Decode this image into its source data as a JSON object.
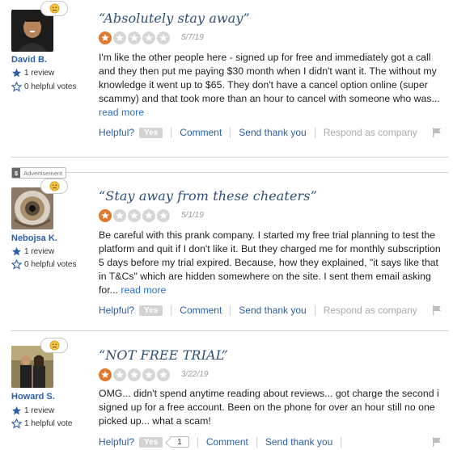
{
  "reviews": [
    {
      "reviewer": "David B.",
      "reviews_count": "1 review",
      "helpful_votes": "0 helpful votes",
      "title": "“Absolutely stay away”",
      "rating": 1,
      "date": "5/7/19",
      "body": "I'm like the other people here - signed up for free and immediately got a call and they then put me paying $30 month when I didn't want it. The without my knowledge it went up to $65. They don't have a cancel option online (super scammy) and that took more than an hour to cancel with someone who was...",
      "read_more": "read more",
      "actions": {
        "helpful": "Helpful?",
        "yes": "Yes",
        "comment": "Comment",
        "thanks": "Send thank you",
        "respond": "Respond as company"
      }
    },
    {
      "reviewer": "Nebojsa K.",
      "reviews_count": "1 review",
      "helpful_votes": "0 helpful votes",
      "title": "“Stay away from these cheaters”",
      "rating": 1,
      "date": "5/1/19",
      "body": "Be careful with this prank company. I started my free trial planning to test the platform and quit if I don't like it. But they charged me for monthly subscription 5 days before my trial expired. Because, how they explained, \"it says like that in T&Cs\" which are hidden somewhere on the site. I sent them email asking for...",
      "read_more": "read more",
      "actions": {
        "helpful": "Helpful?",
        "yes": "Yes",
        "comment": "Comment",
        "thanks": "Send thank you",
        "respond": "Respond as company"
      }
    },
    {
      "reviewer": "Howard S.",
      "reviews_count": "1 review",
      "helpful_votes": "1 helpful vote",
      "title": "“NOT FREE TRIAL”",
      "rating": 1,
      "date": "3/22/19",
      "body": "OMG... didn't spend anytime reading about reviews... got charge the second i signed up for a free account. Been on the phone for over an hour still no one picked up... what a scam!",
      "actions": {
        "helpful": "Helpful?",
        "yes": "Yes",
        "yes_count": "1",
        "comment": "Comment",
        "thanks": "Send thank you"
      }
    }
  ],
  "ad_tag": {
    "symbol": "$",
    "label": "Advertisement"
  },
  "colors": {
    "star_on": "#e2782d",
    "star_off": "#d6d6d6",
    "title": "#2e4f76",
    "link": "#2a5fa8"
  }
}
